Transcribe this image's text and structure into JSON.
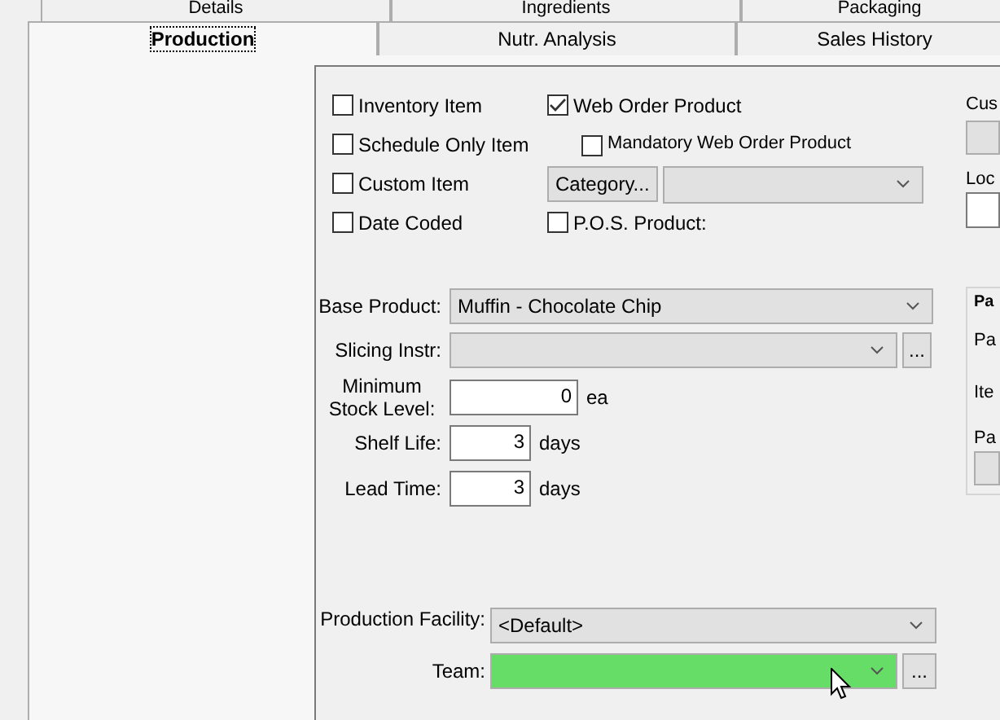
{
  "tabs_row_1": [
    {
      "label": "Details",
      "selected": false
    },
    {
      "label": "Ingredients",
      "selected": false
    },
    {
      "label": "Packaging",
      "selected": false
    }
  ],
  "tabs_row_2": [
    {
      "label": "Production",
      "selected": true
    },
    {
      "label": "Nutr. Analysis",
      "selected": false
    },
    {
      "label": "Sales History",
      "selected": false
    }
  ],
  "item_options": [
    {
      "label": "Inventory Item",
      "checked": false
    },
    {
      "label": "Schedule Only Item",
      "checked": false
    },
    {
      "label": "Custom Item",
      "checked": false
    },
    {
      "label": "Date Coded",
      "checked": false
    }
  ],
  "web_order_product": {
    "label": "Web Order Product",
    "checked": true
  },
  "mandatory_web_order_product": {
    "label": "Mandatory Web Order Product",
    "checked": false
  },
  "category_button": "Category...",
  "pos_product": {
    "label": "P.O.S. Product:",
    "checked": false
  },
  "base_product": {
    "label": "Base Product:",
    "value": "Muffin - Chocolate Chip"
  },
  "slicing_instr": {
    "label": "Slicing Instr:",
    "browse_button": "..."
  },
  "minimum_stock_level": {
    "label": "Minimum Stock Level:",
    "value": "0",
    "unit": "ea"
  },
  "shelf_life": {
    "label": "Shelf Life:",
    "value": "3",
    "unit": "days"
  },
  "lead_time": {
    "label": "Lead Time:",
    "value": "3",
    "unit": "days"
  },
  "production_facility": {
    "label": "Production Facility:",
    "value": "<Default>"
  },
  "team": {
    "label": "Team:",
    "highlighted": true,
    "browse_button": "..."
  },
  "right_panel": {
    "label_1": "Cus",
    "label_2": "Loc",
    "group_title": "Pa",
    "group_labels": [
      "Pa",
      "Ite",
      "Pa"
    ]
  }
}
